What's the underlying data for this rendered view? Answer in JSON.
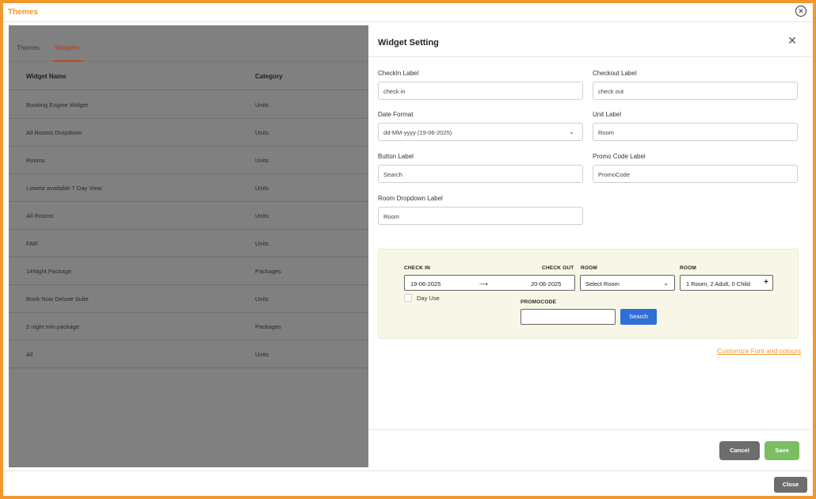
{
  "app": {
    "title": "Themes"
  },
  "left": {
    "tabs": [
      {
        "label": "Themes"
      },
      {
        "label": "Widgets"
      }
    ],
    "table": {
      "headers": {
        "name": "Widget Name",
        "category": "Category"
      },
      "rows": [
        {
          "name": "Booking Engine Widget",
          "category": "Units"
        },
        {
          "name": "All Rooms Dropdown",
          "category": "Units"
        },
        {
          "name": "Rooms",
          "category": "Units"
        },
        {
          "name": "Lowest available 7 Day View",
          "category": "Units"
        },
        {
          "name": "All Rooms",
          "category": "Units"
        },
        {
          "name": "FAR",
          "category": "Units"
        },
        {
          "name": "14Night Package",
          "category": "Packages"
        },
        {
          "name": "Book Now Deluxe Suite",
          "category": "Units"
        },
        {
          "name": "2 night min package",
          "category": "Packages"
        },
        {
          "name": "All",
          "category": "Units"
        }
      ]
    }
  },
  "drawer": {
    "title": "Widget Setting",
    "fields": {
      "checkin": {
        "label": "CheckIn Label",
        "value": "check in"
      },
      "checkout": {
        "label": "Checkout Label",
        "value": "check out"
      },
      "date_format": {
        "label": "Date Format",
        "value": "dd-MM-yyyy (19-06-2025)"
      },
      "unit": {
        "label": "Unit Label",
        "value": "Room"
      },
      "button": {
        "label": "Button Label",
        "value": "Search"
      },
      "promo": {
        "label": "Promo Code Label",
        "value": "PromoCode"
      },
      "room_dropdown": {
        "label": "Room Dropdown Label",
        "value": "Room"
      }
    },
    "preview": {
      "checkin_label": "CHECK IN",
      "checkout_label": "CHECK OUT",
      "room_label_1": "ROOM",
      "room_label_2": "ROOM",
      "checkin_date": "19-06-2025",
      "arrow": "⟶",
      "checkout_date": "20-06-2025",
      "room_select": "Select Room",
      "guests": "1 Room, 2 Adult, 0 Child",
      "plus": "+",
      "day_use": "Day Use",
      "promocode_label": "PROMOCODE",
      "search_button": "Search"
    },
    "customize_link": "Customize Font and colours",
    "cancel": "Cancel",
    "save": "Save"
  },
  "footer": {
    "close": "Close"
  },
  "icons": {
    "close": "close-icon",
    "chevron": "chevron-down-icon"
  }
}
